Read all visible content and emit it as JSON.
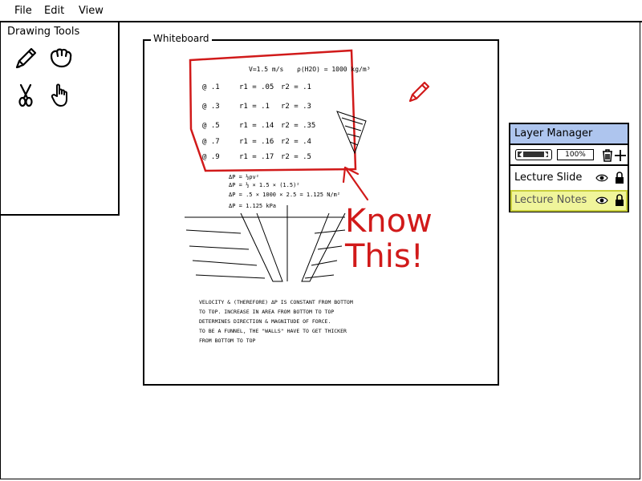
{
  "menu": {
    "file": "File",
    "edit": "Edit",
    "view": "View"
  },
  "tools_panel": {
    "title": "Drawing Tools",
    "tools": [
      "pencil-icon",
      "hand-grab-icon",
      "scissors-icon",
      "hand-pointer-icon"
    ]
  },
  "whiteboard": {
    "label": "Whiteboard",
    "annotation": {
      "line1": "Know",
      "line2": "This!",
      "color": "#d11a1a"
    },
    "table_header": [
      "V=1.5 m/s",
      "ρ(H2O) = 1000 kg/m³"
    ],
    "table_rows": [
      {
        "y": "@ .1",
        "r1": "r1 = .05",
        "r2": "r2 = .1"
      },
      {
        "y": "@ .3",
        "r1": "r1 = .1",
        "r2": "r2 = .3"
      },
      {
        "y": "@ .5",
        "r1": "r1 = .14",
        "r2": "r2 = .35"
      },
      {
        "y": "@ .7",
        "r1": "r1 = .16",
        "r2": "r2 = .4"
      },
      {
        "y": "@ .9",
        "r1": "r1 = .17",
        "r2": "r2 = .5"
      }
    ],
    "calc_lines": [
      "ΔP = ½ρv²",
      "ΔP = ½ × 1.5 × (1.5)²",
      "ΔP = .5 × 1000 × 2.5 = 1.125 N/m²",
      "ΔP = 1.125 kPa"
    ],
    "notes_lines": [
      "VELOCITY & (THEREFORE) ΔP IS CONSTANT FROM BOTTOM",
      "TO TOP. INCREASE IN AREA FROM BOTTOM TO TOP",
      "DETERMINES DIRECTION & MAGNITUDE OF FORCE.",
      "TO BE A FUNNEL, THE \"WALLS\" HAVE TO GET THICKER",
      "FROM BOTTOM TO TOP"
    ]
  },
  "layer_manager": {
    "title": "Layer Manager",
    "zoom": "100%",
    "slider_value": 0.9,
    "layers": [
      {
        "name": "Lecture Slide",
        "selected": false
      },
      {
        "name": "Lecture Notes",
        "selected": true
      }
    ],
    "accent": "#aec5ee",
    "selected_color": "#f0f59b"
  }
}
